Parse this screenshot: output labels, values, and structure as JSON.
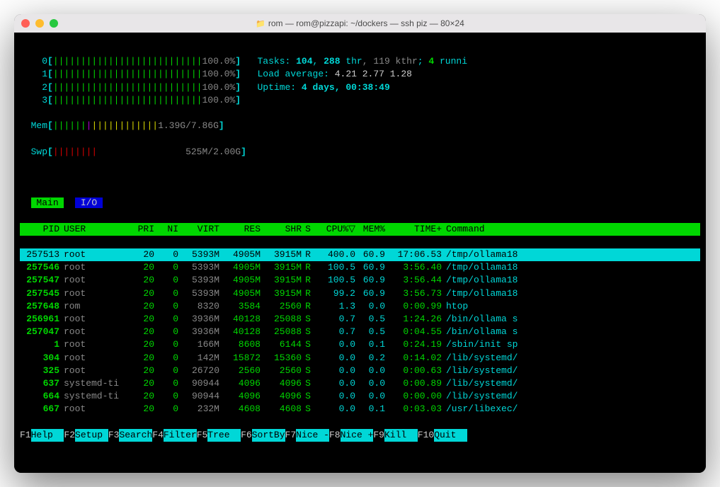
{
  "window_title": "rom — rom@pizzapi: ~/dockers — ssh piz — 80×24",
  "cpus": [
    {
      "id": "0",
      "bar": "|||||||||||||||||||||||||||",
      "pct": "100.0%"
    },
    {
      "id": "1",
      "bar": "|||||||||||||||||||||||||||",
      "pct": "100.0%"
    },
    {
      "id": "2",
      "bar": "|||||||||||||||||||||||||||",
      "pct": "100.0%"
    },
    {
      "id": "3",
      "bar": "|||||||||||||||||||||||||||",
      "pct": "100.0%"
    }
  ],
  "mem": {
    "label": "Mem",
    "bar_g": "||||||",
    "bar_m": "|",
    "bar_y": "||||||||||||",
    "text": "1.39G/7.86G"
  },
  "swp": {
    "label": "Swp",
    "bar_r": "||||||||",
    "text": "525M/2.00G"
  },
  "tasks": {
    "label": "Tasks: ",
    "tasks": "104",
    "sep1": ", ",
    "thr": "288",
    "thr_l": " thr",
    "sep2": ", ",
    "kthr": "119 kthr",
    "sep3": "; ",
    "running": "4",
    "running_l": " runni"
  },
  "load": {
    "label": "Load average: ",
    "v1": "4.21",
    "v2": "2.77",
    "v3": "1.28"
  },
  "uptime": {
    "label": "Uptime: ",
    "value": "4 days, 00:38:49"
  },
  "tabs": {
    "main": " Main ",
    "io": " I/O "
  },
  "header": {
    "pid": "PID",
    "user": "USER",
    "pri": "PRI",
    "ni": "NI",
    "virt": "VIRT",
    "res": "RES",
    "shr": "SHR",
    "s": "S",
    "cpu": "CPU%▽",
    "mem": "MEM%",
    "time": "TIME+",
    "cmd": "Command"
  },
  "rows": [
    {
      "pid": "257513",
      "user": "root",
      "pri": "20",
      "ni": "0",
      "virt": "5393M",
      "res": "4905M",
      "shr": "3915M",
      "s": "R",
      "cpu": "400.0",
      "mem": "60.9",
      "time": "17:06.53",
      "cmd": "/tmp/ollama18",
      "hl": true
    },
    {
      "pid": "257546",
      "user": "root",
      "pri": "20",
      "ni": "0",
      "virt": "5393M",
      "res": "4905M",
      "shr": "3915M",
      "s": "R",
      "cpu": "100.5",
      "mem": "60.9",
      "time": "3:56.40",
      "cmd": "/tmp/ollama18"
    },
    {
      "pid": "257547",
      "user": "root",
      "pri": "20",
      "ni": "0",
      "virt": "5393M",
      "res": "4905M",
      "shr": "3915M",
      "s": "R",
      "cpu": "100.5",
      "mem": "60.9",
      "time": "3:56.44",
      "cmd": "/tmp/ollama18"
    },
    {
      "pid": "257545",
      "user": "root",
      "pri": "20",
      "ni": "0",
      "virt": "5393M",
      "res": "4905M",
      "shr": "3915M",
      "s": "R",
      "cpu": "99.2",
      "mem": "60.9",
      "time": "3:56.73",
      "cmd": "/tmp/ollama18"
    },
    {
      "pid": "257648",
      "user": "rom",
      "pri": "20",
      "ni": "0",
      "virt": "8320",
      "res": "3584",
      "shr": "2560",
      "s": "R",
      "cpu": "1.3",
      "mem": "0.0",
      "time": "0:00.99",
      "cmd": "htop"
    },
    {
      "pid": "256961",
      "user": "root",
      "pri": "20",
      "ni": "0",
      "virt": "3936M",
      "res": "40128",
      "shr": "25088",
      "s": "S",
      "cpu": "0.7",
      "mem": "0.5",
      "time": "1:24.26",
      "cmd": "/bin/ollama s"
    },
    {
      "pid": "257047",
      "user": "root",
      "pri": "20",
      "ni": "0",
      "virt": "3936M",
      "res": "40128",
      "shr": "25088",
      "s": "S",
      "cpu": "0.7",
      "mem": "0.5",
      "time": "0:04.55",
      "cmd": "/bin/ollama s"
    },
    {
      "pid": "1",
      "user": "root",
      "pri": "20",
      "ni": "0",
      "virt": "166M",
      "res": "8608",
      "shr": "6144",
      "s": "S",
      "cpu": "0.0",
      "mem": "0.1",
      "time": "0:24.19",
      "cmd": "/sbin/init sp"
    },
    {
      "pid": "304",
      "user": "root",
      "pri": "20",
      "ni": "0",
      "virt": "142M",
      "res": "15872",
      "shr": "15360",
      "s": "S",
      "cpu": "0.0",
      "mem": "0.2",
      "time": "0:14.02",
      "cmd": "/lib/systemd/"
    },
    {
      "pid": "325",
      "user": "root",
      "pri": "20",
      "ni": "0",
      "virt": "26720",
      "res": "2560",
      "shr": "2560",
      "s": "S",
      "cpu": "0.0",
      "mem": "0.0",
      "time": "0:00.63",
      "cmd": "/lib/systemd/"
    },
    {
      "pid": "637",
      "user": "systemd-ti",
      "pri": "20",
      "ni": "0",
      "virt": "90944",
      "res": "4096",
      "shr": "4096",
      "s": "S",
      "cpu": "0.0",
      "mem": "0.0",
      "time": "0:00.89",
      "cmd": "/lib/systemd/"
    },
    {
      "pid": "664",
      "user": "systemd-ti",
      "pri": "20",
      "ni": "0",
      "virt": "90944",
      "res": "4096",
      "shr": "4096",
      "s": "S",
      "cpu": "0.0",
      "mem": "0.0",
      "time": "0:00.00",
      "cmd": "/lib/systemd/"
    },
    {
      "pid": "667",
      "user": "root",
      "pri": "20",
      "ni": "0",
      "virt": "232M",
      "res": "4608",
      "shr": "4608",
      "s": "S",
      "cpu": "0.0",
      "mem": "0.1",
      "time": "0:03.03",
      "cmd": "/usr/libexec/"
    }
  ],
  "fkeys": [
    {
      "k": "F1",
      "l": "Help  "
    },
    {
      "k": "F2",
      "l": "Setup "
    },
    {
      "k": "F3",
      "l": "Search"
    },
    {
      "k": "F4",
      "l": "Filter"
    },
    {
      "k": "F5",
      "l": "Tree  "
    },
    {
      "k": "F6",
      "l": "SortBy"
    },
    {
      "k": "F7",
      "l": "Nice -"
    },
    {
      "k": "F8",
      "l": "Nice +"
    },
    {
      "k": "F9",
      "l": "Kill  "
    },
    {
      "k": "F10",
      "l": "Quit  "
    }
  ]
}
